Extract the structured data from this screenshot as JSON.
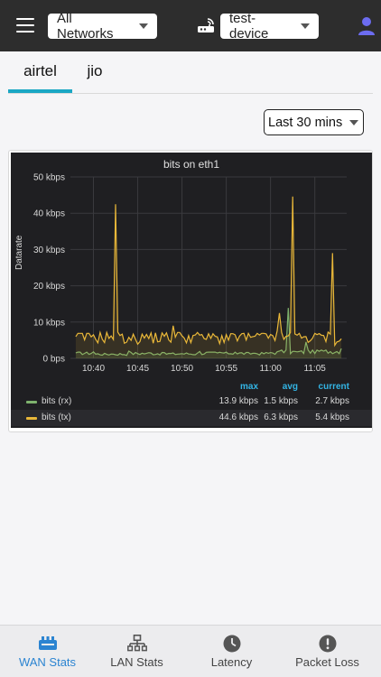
{
  "topbar": {
    "network_select": "All Networks",
    "device_select": "test-device"
  },
  "tabs": [
    {
      "label": "airtel",
      "active": true
    },
    {
      "label": "jio",
      "active": false
    }
  ],
  "time_range": "Last 30 mins",
  "panel": {
    "title": "bits on eth1",
    "ylabel": "Datarate",
    "legend_headers": {
      "max": "max",
      "avg": "avg",
      "current": "current"
    },
    "legend": [
      {
        "name": "bits (rx)",
        "color": "#7eb26d",
        "max": "13.9 kbps",
        "avg": "1.5 kbps",
        "current": "2.7 kbps"
      },
      {
        "name": "bits (tx)",
        "color": "#eab839",
        "max": "44.6 kbps",
        "avg": "6.3 kbps",
        "current": "5.4 kbps"
      }
    ]
  },
  "chart_data": {
    "type": "line",
    "title": "bits on eth1",
    "ylabel": "Datarate",
    "y_ticks": [
      "0 bps",
      "10 kbps",
      "20 kbps",
      "30 kbps",
      "40 kbps",
      "50 kbps"
    ],
    "x_ticks": [
      "10:40",
      "10:45",
      "10:50",
      "10:55",
      "11:00",
      "11:05"
    ],
    "ylim": [
      0,
      50
    ],
    "y_unit": "kbps",
    "grid": true,
    "legend_placement": "bottom",
    "series": [
      {
        "name": "bits (rx)",
        "color": "#7eb26d",
        "x": [
          "10:38",
          "10:40",
          "10:42",
          "10:44",
          "10:46",
          "10:48",
          "10:50",
          "10:52",
          "10:54",
          "10:56",
          "10:58",
          "11:00",
          "11:01",
          "11:02",
          "11:03",
          "11:04",
          "11:06",
          "11:08"
        ],
        "values": [
          1.5,
          1.8,
          1.2,
          2.0,
          1.4,
          1.6,
          1.3,
          1.9,
          1.5,
          1.7,
          1.4,
          1.6,
          2.0,
          13.9,
          1.8,
          4.5,
          2.0,
          2.7
        ]
      },
      {
        "name": "bits (tx)",
        "color": "#eab839",
        "x": [
          "10:38",
          "10:40",
          "10:42",
          "10:42.5",
          "10:43",
          "10:44",
          "10:46",
          "10:48",
          "10:49",
          "10:50",
          "10:52",
          "10:54",
          "10:56",
          "10:58",
          "11:00",
          "11:01",
          "11:02",
          "11:02.5",
          "11:03",
          "11:04",
          "11:06",
          "11:07",
          "11:08"
        ],
        "values": [
          6.0,
          6.5,
          6.2,
          42.5,
          6.3,
          5.8,
          6.6,
          6.1,
          9.0,
          6.2,
          6.4,
          5.9,
          6.5,
          6.0,
          6.6,
          12.5,
          6.2,
          44.6,
          6.4,
          6.0,
          6.3,
          29.0,
          5.4
        ]
      }
    ]
  },
  "bottom_nav": [
    {
      "label": "WAN Stats",
      "icon": "wan-icon",
      "active": true
    },
    {
      "label": "LAN Stats",
      "icon": "lan-icon",
      "active": false
    },
    {
      "label": "Latency",
      "icon": "clock-icon",
      "active": false
    },
    {
      "label": "Packet Loss",
      "icon": "alert-icon",
      "active": false
    }
  ]
}
